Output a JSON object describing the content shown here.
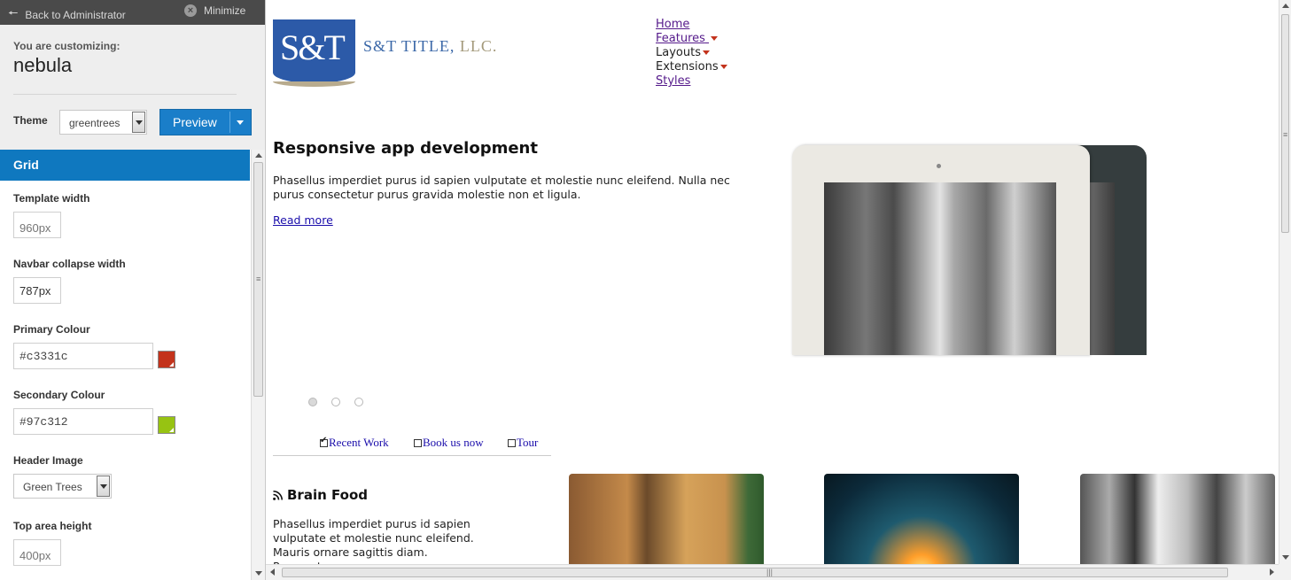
{
  "topbar": {
    "back_label": "Back to Administrator",
    "minimize_label": "Minimize"
  },
  "customizer": {
    "customizing_label": "You are customizing:",
    "template_name": "nebula",
    "theme_label": "Theme",
    "theme_value": "greentrees",
    "preview_label": "Preview"
  },
  "panel": {
    "section_title": "Grid",
    "fields": {
      "template_width": {
        "label": "Template width",
        "placeholder": "960px"
      },
      "navbar_collapse": {
        "label": "Navbar collapse width",
        "value": "787px"
      },
      "primary_colour": {
        "label": "Primary Colour",
        "value": "#c3331c",
        "swatch": "#c3331c"
      },
      "secondary_colour": {
        "label": "Secondary Colour",
        "value": "#97c312",
        "swatch": "#97c312"
      },
      "header_image": {
        "label": "Header Image",
        "value": "Green Trees"
      },
      "top_area_height": {
        "label": "Top area height",
        "placeholder": "400px"
      }
    }
  },
  "site": {
    "logo": {
      "monogram": "S&T",
      "company_name": "S&T TITLE,",
      "company_suffix": " LLC."
    },
    "nav": [
      {
        "label": "Home",
        "link": true,
        "dropdown": false
      },
      {
        "label": "Features",
        "link": true,
        "dropdown": true
      },
      {
        "label": "Layouts",
        "link": false,
        "dropdown": true
      },
      {
        "label": "Extensions",
        "link": false,
        "dropdown": true
      },
      {
        "label": "Styles",
        "link": true,
        "dropdown": false
      }
    ],
    "hero": {
      "title": "Responsive app development",
      "text": "Phasellus imperdiet purus id sapien vulputate et molestie nunc eleifend. Nulla nec purus consectetur purus gravida molestie non et ligula.",
      "read_more": "Read more"
    },
    "slider_dots": 3,
    "slider_active": 0,
    "tabs": [
      {
        "label": "Recent Work",
        "checked": true
      },
      {
        "label": "Book us now",
        "checked": false
      },
      {
        "label": "Tour",
        "checked": false
      }
    ],
    "brain_food": {
      "title": "Brain Food",
      "icon": "rss-icon",
      "text": "Phasellus imperdiet purus id sapien vulputate et molestie nunc eleifend. Mauris ornare sagittis diam. Praesent"
    },
    "gallery": [
      "street-photo-color",
      "sunrise-photo",
      "street-photo-bw"
    ]
  },
  "colors": {
    "accent": "#0f78bf",
    "primary": "#c3331c",
    "secondary": "#97c312",
    "topbar": "#4a4a4a"
  }
}
